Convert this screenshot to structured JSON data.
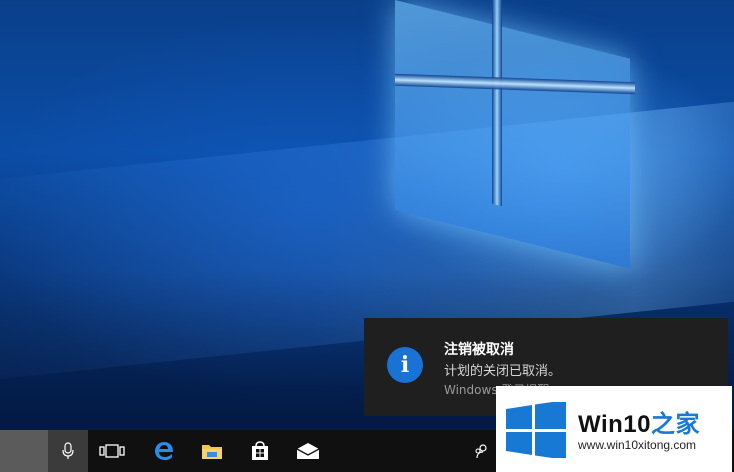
{
  "notification": {
    "title": "注销被取消",
    "body": "计划的关闭已取消。",
    "source": "Windows 登录提醒",
    "icon": "info-icon",
    "accent": "#1a73d4"
  },
  "taskbar": {
    "buttons": [
      {
        "name": "cortana-search",
        "icon": "search-box"
      },
      {
        "name": "microphone",
        "icon": "microphone-icon"
      },
      {
        "name": "task-view",
        "icon": "task-view-icon"
      },
      {
        "name": "edge",
        "icon": "edge-icon"
      },
      {
        "name": "file-explorer",
        "icon": "folder-icon"
      },
      {
        "name": "store",
        "icon": "store-icon"
      },
      {
        "name": "mail",
        "icon": "mail-icon"
      },
      {
        "name": "people",
        "icon": "people-icon"
      }
    ]
  },
  "watermark": {
    "brand": "Win10",
    "brand_suffix": "之家",
    "url": "www.win10xitong.com"
  }
}
